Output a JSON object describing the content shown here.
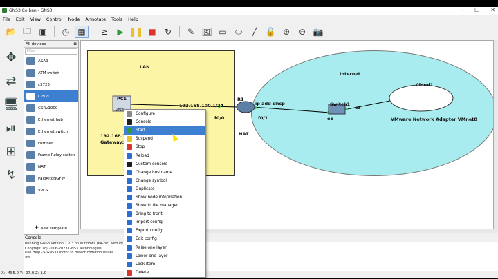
{
  "window": {
    "title": "GNS3 Co ban - GNS3",
    "controls": [
      "–",
      "☐",
      "✕"
    ]
  },
  "menu": [
    "File",
    "Edit",
    "View",
    "Control",
    "Node",
    "Annotate",
    "Tools",
    "Help"
  ],
  "toolbar": {
    "icons": [
      "open-folder-icon",
      "folder-icon",
      "snapshot-icon",
      "clock-icon",
      "grid-icon",
      "console-icon",
      "start-icon",
      "pause-icon",
      "stop-icon",
      "reload-icon",
      "note-icon",
      "image-icon",
      "rectangle-icon",
      "ellipse-icon",
      "line-icon",
      "lock-icon",
      "zoom-in-icon",
      "zoom-out-icon",
      "screenshot-icon"
    ]
  },
  "device_panel": {
    "header": "All devices",
    "filter_placeholder": "Filter",
    "items": [
      "ASA9",
      "ATM switch",
      "c3725",
      "Cloud",
      "CSRv1000",
      "Ethernet hub",
      "Ethernet switch",
      "Fortinet",
      "Frame Relay switch",
      "NAT",
      "PaloAltoNGFW",
      "VPCS"
    ],
    "selected_index": 3,
    "new_template": "New template"
  },
  "topology": {
    "lan_label": "LAN",
    "internet_label": "Internet",
    "pc1": "PC1",
    "pc1_icon": "VPCS",
    "pc1_ip": "192.168.10",
    "pc1_gw": "Gateway: 1",
    "r1": "R1",
    "r1_ip": "192.168.100.1/24",
    "r1_f00": "f0/0",
    "r1_f01": "f0/1",
    "dhcp": "ip add dhcp",
    "nat": "NAT",
    "switch1": "Switch1",
    "sw_e5": "e5",
    "sw_e3": "e3",
    "cloud1": "Cloud1",
    "vmnet": "VMware Network Adapter VMnet8"
  },
  "context_menu": {
    "items": [
      "Configure",
      "Console",
      "Start",
      "Suspend",
      "Stop",
      "Reload",
      "Custom console",
      "Change hostname",
      "Change symbol",
      "Duplicate",
      "Show node information",
      "Show in file manager",
      "Bring to front",
      "Import config",
      "Export config",
      "Edit config",
      "Raise one layer",
      "Lower one layer",
      "Lock item",
      "Delete"
    ],
    "highlighted_index": 2,
    "icon_colors": [
      "#8a8a8a",
      "#1f1f1f",
      "#2e9c3a",
      "#e8c02b",
      "#d9362b",
      "#2b6fd1",
      "#1f1f1f",
      "#2b6fd1",
      "#2b6fd1",
      "#2b6fd1",
      "#2b6fd1",
      "#2b6fd1",
      "#2b6fd1",
      "#2b6fd1",
      "#2b6fd1",
      "#2b6fd1",
      "#2b6fd1",
      "#2b6fd1",
      "#2b6fd1",
      "#d9362b"
    ]
  },
  "console": {
    "header": "Console",
    "lines": [
      "Running GNS3 version 2.2.3 on Windows (64-bit) with Py",
      "Copyright (c) 2006-2023 GNS3 Technologies.",
      "Use Help -> GNS3 Doctor to detect common issues.",
      "",
      "=>"
    ]
  },
  "status": "X: -455.0 Y: -97.0 Z: 1.0"
}
